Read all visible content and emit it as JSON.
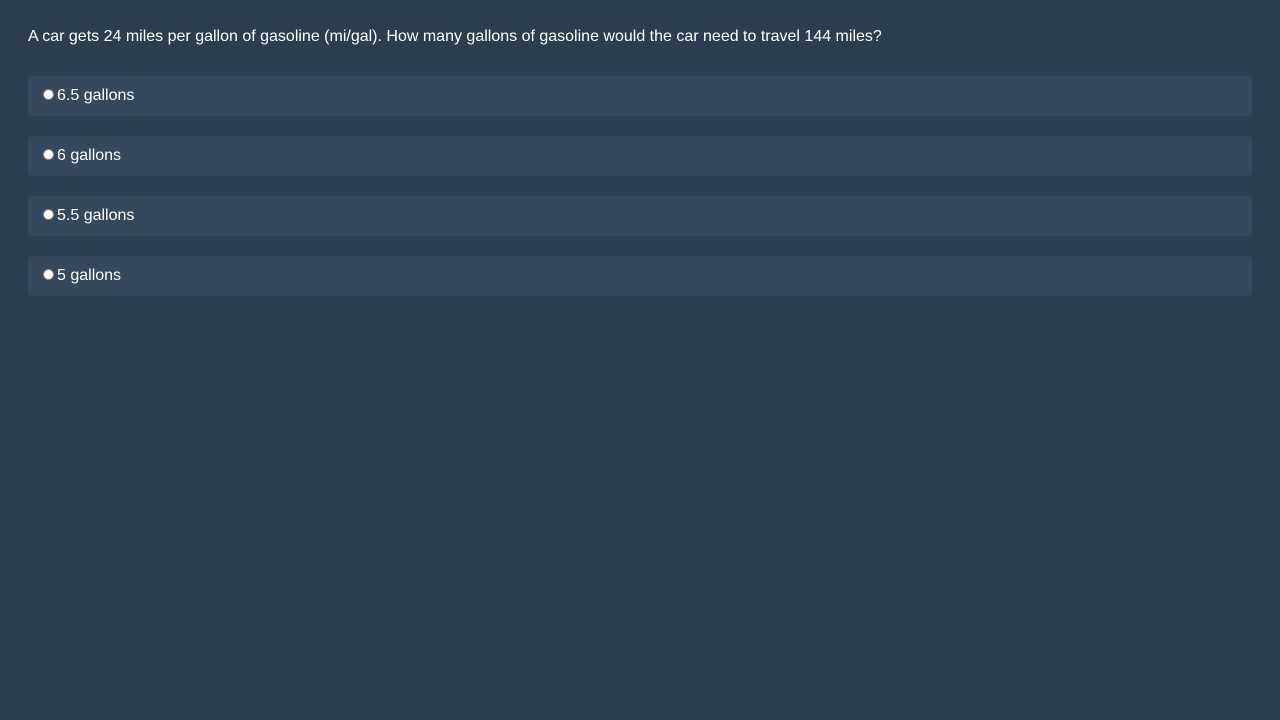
{
  "question": {
    "text": "A car gets 24 miles per gallon of gasoline (mi/gal). How many gallons of gasoline would the car need to travel 144 miles?"
  },
  "options": [
    {
      "label": "6.5 gallons",
      "selected": false
    },
    {
      "label": "6 gallons",
      "selected": false
    },
    {
      "label": "5.5 gallons",
      "selected": false
    },
    {
      "label": "5 gallons",
      "selected": false
    }
  ],
  "colors": {
    "background": "#2d3d50",
    "option_background": "#34495e",
    "text": "#ffffff"
  }
}
